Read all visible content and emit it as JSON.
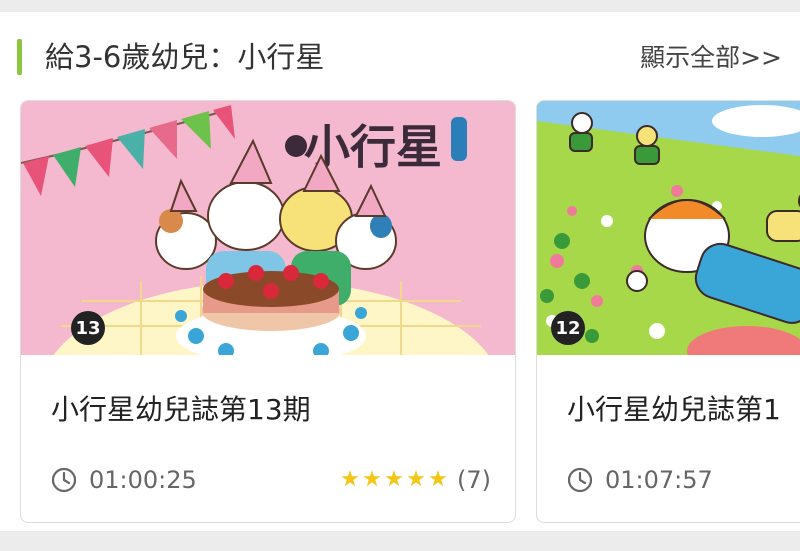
{
  "section": {
    "title": "給3-6歲幼兒：小行星",
    "show_all": "顯示全部>>",
    "accent_color": "#8cc63f"
  },
  "cards": [
    {
      "cover_logo": "小行星",
      "issue_badge": "13",
      "title": "小行星幼兒誌第13期",
      "duration": "01:00:25",
      "rating_stars": 5,
      "rating_count": "(7)",
      "clock_icon": "clock-icon",
      "star_color": "#f5c518"
    },
    {
      "issue_badge": "12",
      "title": "小行星幼兒誌第1",
      "duration": "01:07:57",
      "clock_icon": "clock-icon"
    }
  ]
}
